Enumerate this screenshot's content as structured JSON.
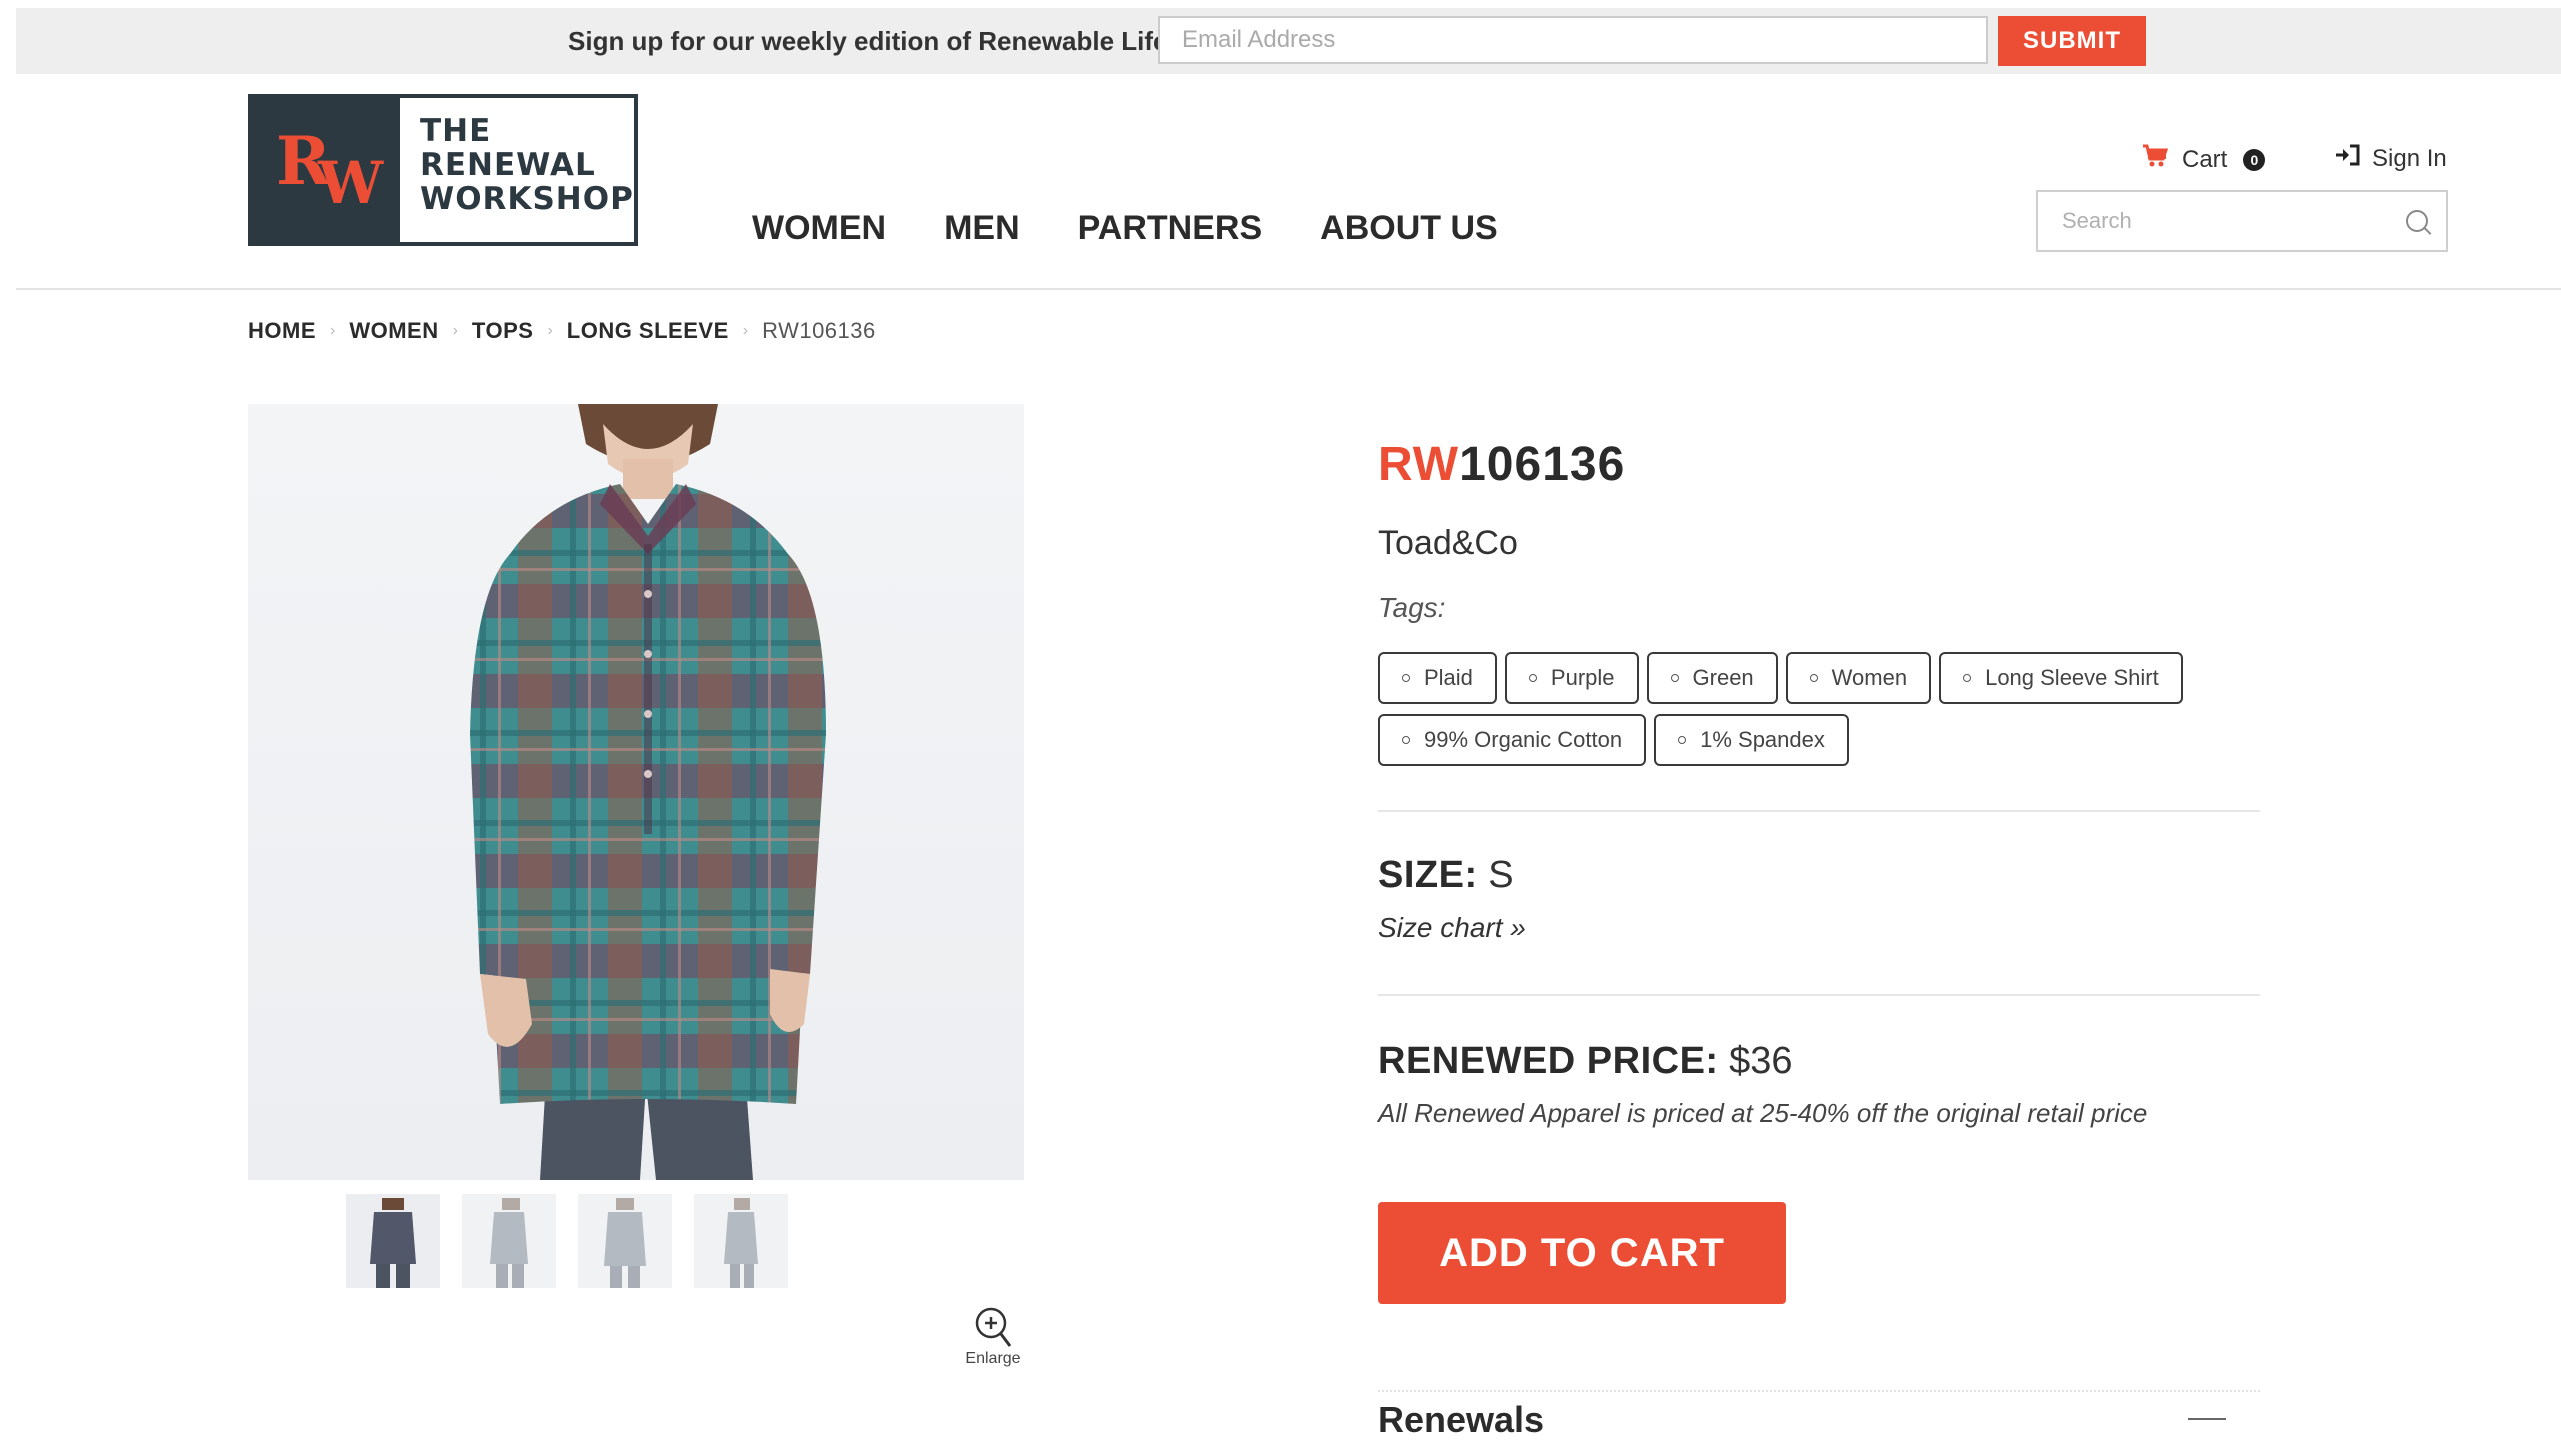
{
  "newsletter": {
    "text": "Sign up for our weekly edition of Renewable Life",
    "email_placeholder": "Email Address",
    "submit_label": "SUBMIT"
  },
  "logo": {
    "mark_r": "R",
    "mark_w": "W",
    "line1": "THE",
    "line2": "RENEWAL",
    "line3": "WORKSHOP"
  },
  "nav": {
    "items": [
      {
        "label": "WOMEN"
      },
      {
        "label": "MEN"
      },
      {
        "label": "PARTNERS"
      },
      {
        "label": "ABOUT US"
      }
    ]
  },
  "account": {
    "cart_label": "Cart",
    "cart_count": "0",
    "signin_label": "Sign In",
    "cart_icon": "cart-icon",
    "signin_icon": "sign-in-icon"
  },
  "search": {
    "placeholder": "Search",
    "icon": "search-icon"
  },
  "breadcrumb": {
    "items": [
      "HOME",
      "WOMEN",
      "TOPS",
      "LONG SLEEVE"
    ],
    "current": "RW106136",
    "separator": "›"
  },
  "product": {
    "title_prefix": "RW",
    "title_number": "106136",
    "brand": "Toad&Co",
    "tags_label": "Tags:",
    "tags": [
      "Plaid",
      "Purple",
      "Green",
      "Women",
      "Long Sleeve Shirt",
      "99% Organic Cotton",
      "1% Spandex"
    ],
    "size_label": "SIZE:",
    "size_value": "S",
    "size_chart_link": "Size chart »",
    "price_label": "RENEWED PRICE:",
    "price_value": "$36",
    "price_note": "All Renewed Apparel is priced at 25-40% off the original retail price",
    "add_to_cart_label": "ADD TO CART",
    "enlarge_label": "Enlarge",
    "thumbnail_count": 4,
    "active_thumbnail": 1
  },
  "accordion": {
    "renewals_title": "Renewals",
    "renewals_expanded": true
  },
  "colors": {
    "accent": "#ec4e35",
    "logo_dark": "#2c3940",
    "text": "#2b2b2b",
    "plaid_teal": "#3f8d8f",
    "plaid_plum": "#7a3d5c",
    "plaid_rust": "#9a5a46",
    "pants": "#4c5462"
  }
}
